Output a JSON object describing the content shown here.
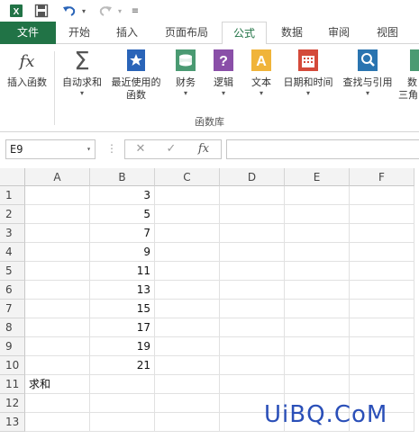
{
  "ribbon_tabs": [
    "文件",
    "开始",
    "插入",
    "页面布局",
    "公式",
    "数据",
    "审阅",
    "视图"
  ],
  "ribbon": {
    "buttons": [
      {
        "label": "插入函数",
        "label2": "",
        "icon": "fx-icon",
        "dropdown": false
      },
      {
        "label": "自动求和",
        "label2": "",
        "icon": "sigma-icon",
        "dropdown": true
      },
      {
        "label": "最近使用的",
        "label2": "函数",
        "icon": "star-book-icon",
        "dropdown": true
      },
      {
        "label": "财务",
        "label2": "",
        "icon": "finance-icon",
        "dropdown": true
      },
      {
        "label": "逻辑",
        "label2": "",
        "icon": "logic-icon",
        "dropdown": true
      },
      {
        "label": "文本",
        "label2": "",
        "icon": "text-icon",
        "dropdown": true
      },
      {
        "label": "日期和时间",
        "label2": "",
        "icon": "calendar-icon",
        "dropdown": true
      },
      {
        "label": "查找与引用",
        "label2": "",
        "icon": "lookup-icon",
        "dropdown": true
      },
      {
        "label": "数",
        "label2": "三角",
        "icon": "math-icon",
        "dropdown": false
      }
    ],
    "group_label": "函数库"
  },
  "formula_bar": {
    "name_box": "E9",
    "fx_label": "fx",
    "cancel_symbol": "✕",
    "enter_symbol": "✓",
    "value": ""
  },
  "columns": [
    "A",
    "B",
    "C",
    "D",
    "E",
    "F"
  ],
  "rows": [
    {
      "n": "1",
      "a": "",
      "b": "3"
    },
    {
      "n": "2",
      "a": "",
      "b": "5"
    },
    {
      "n": "3",
      "a": "",
      "b": "7"
    },
    {
      "n": "4",
      "a": "",
      "b": "9"
    },
    {
      "n": "5",
      "a": "",
      "b": "11"
    },
    {
      "n": "6",
      "a": "",
      "b": "13"
    },
    {
      "n": "7",
      "a": "",
      "b": "15"
    },
    {
      "n": "8",
      "a": "",
      "b": "17"
    },
    {
      "n": "9",
      "a": "",
      "b": "19"
    },
    {
      "n": "10",
      "a": "",
      "b": "21"
    },
    {
      "n": "11",
      "a": "求和",
      "b": ""
    },
    {
      "n": "12",
      "a": "",
      "b": ""
    },
    {
      "n": "13",
      "a": "",
      "b": ""
    }
  ],
  "watermark": "UiBQ.CoM",
  "colors": {
    "file_tab": "#217346",
    "accent": "#217346",
    "watermark": "#2a4fb8"
  }
}
